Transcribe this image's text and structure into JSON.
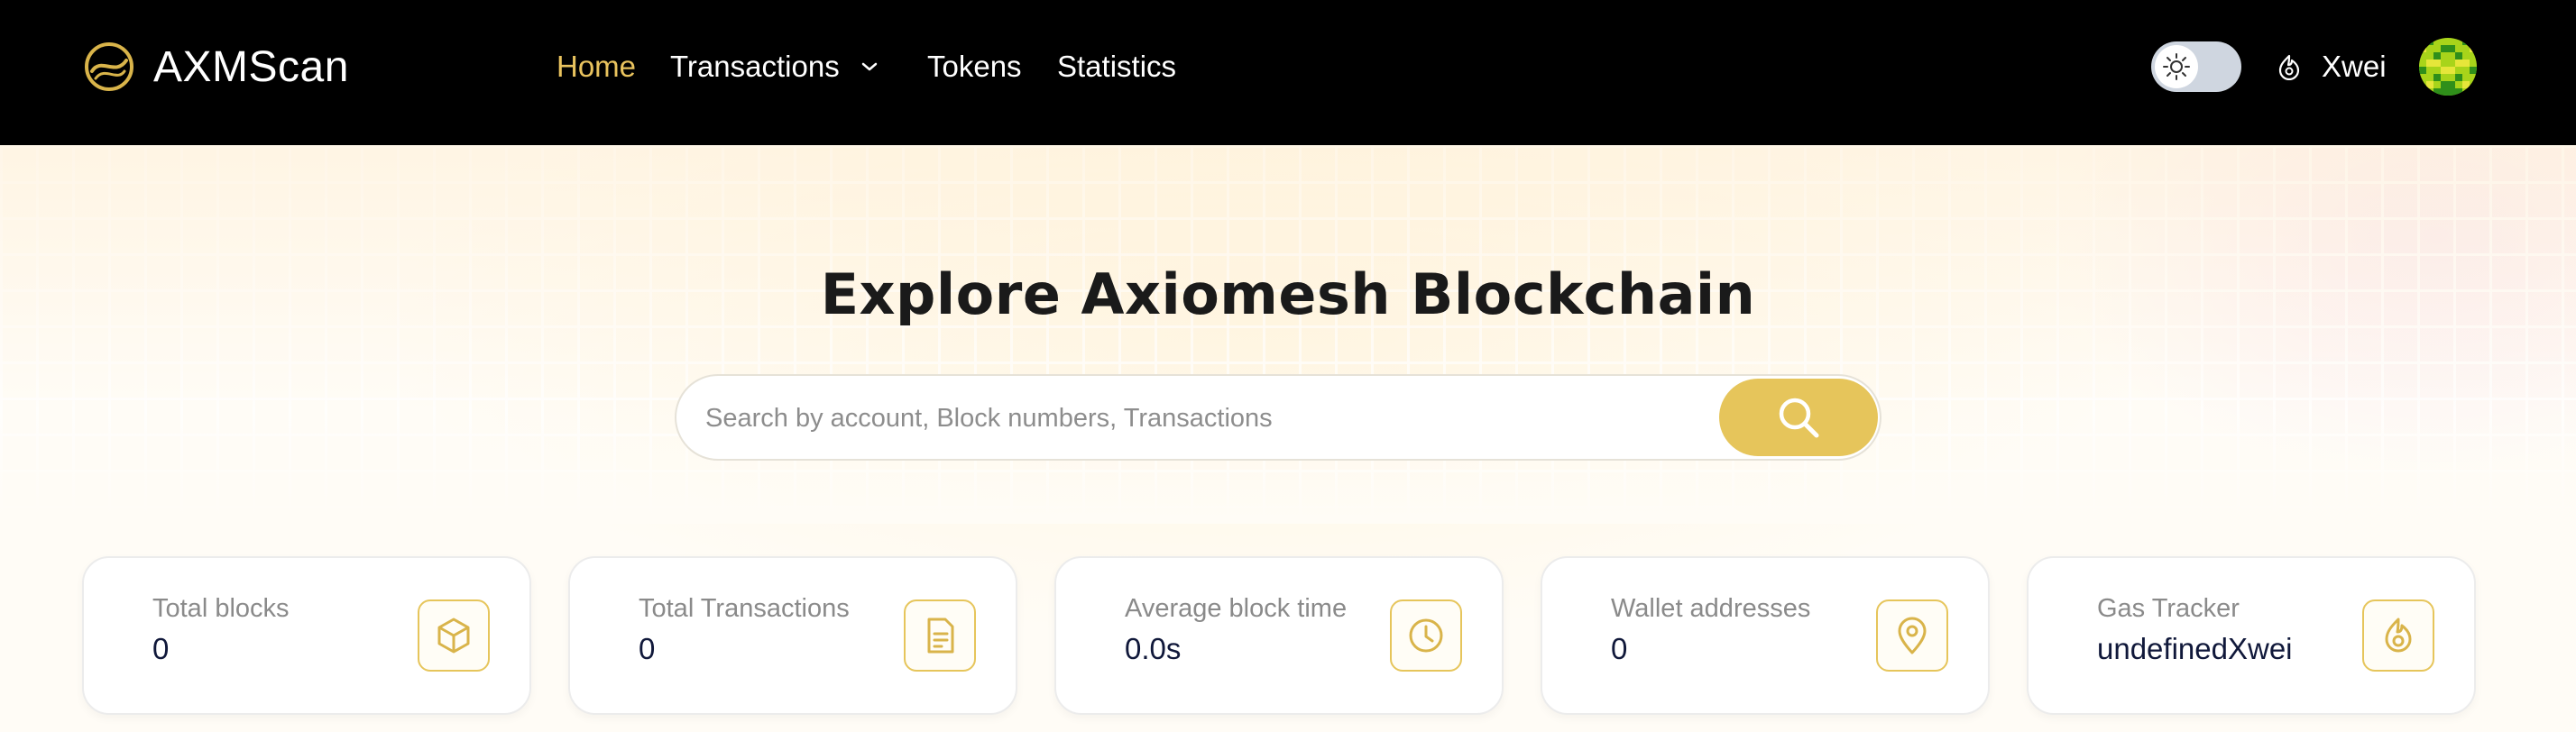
{
  "brand": {
    "name": "AXMScan"
  },
  "nav": {
    "home": "Home",
    "transactions": "Transactions",
    "tokens": "Tokens",
    "statistics": "Statistics"
  },
  "header": {
    "gas_unit": "Xwei"
  },
  "hero": {
    "title": "Explore Axiomesh Blockchain",
    "search_placeholder": "Search by account, Block numbers, Transactions"
  },
  "stats": [
    {
      "label": "Total blocks",
      "value": "0",
      "icon": "cube-icon"
    },
    {
      "label": "Total Transactions",
      "value": "0",
      "icon": "document-icon"
    },
    {
      "label": "Average block time",
      "value": "0.0s",
      "icon": "clock-icon"
    },
    {
      "label": "Wallet addresses",
      "value": "0",
      "icon": "location-pin-icon"
    },
    {
      "label": "Gas Tracker",
      "value": "undefinedXwei",
      "icon": "flame-icon"
    }
  ],
  "colors": {
    "accent": "#e6c55b",
    "header_bg": "#000000",
    "value_text": "#10183a"
  }
}
